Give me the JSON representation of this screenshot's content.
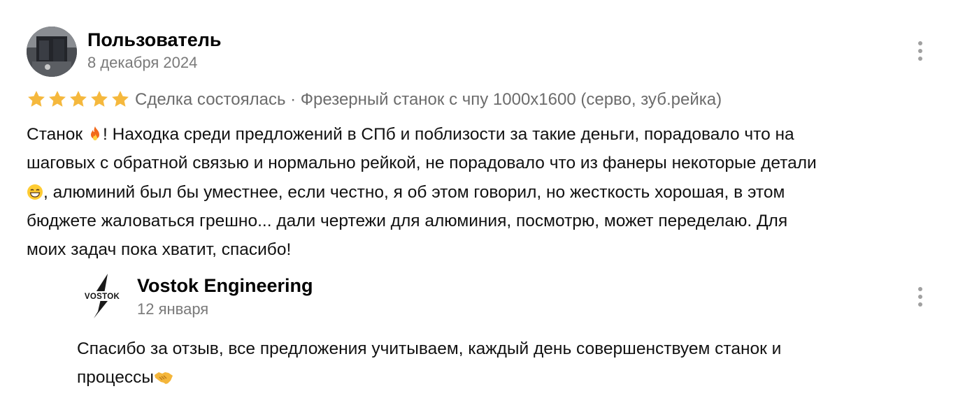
{
  "review": {
    "author": "Пользователь",
    "date": "8 декабря 2024",
    "rating": 5,
    "rating_max": 5,
    "deal_status": "Сделка состоялась · Фрезерный станок с чпу 1000x1600 (серво, зуб.рейка)",
    "text_lines": [
      "Станок ",
      "! Находка среди предложений в СПб и поблизости за такие деньги, порадовало что на",
      "шаговых с обратной связью и нормально рейкой, не порадовало что из фанеры некоторые детали",
      ", алюминий был бы уместнее, если честно, я об этом говорил, но жесткость хорошая, в этом",
      "бюджете жаловаться грешно... дали чертежи для алюминия, посмотрю, может переделаю. Для",
      "моих задач пока хватит, спасибо!"
    ],
    "emoji": [
      "fire-emoji",
      "grin-emoji"
    ],
    "star_color": "#f5b83d"
  },
  "reply": {
    "author": "Vostok Engineering",
    "date": "12 января",
    "logo_text": "VOSTOK",
    "text_lines": [
      "Спасибо за отзыв, все предложения учитываем, каждый день совершенствуем станок и",
      "процессы"
    ],
    "emoji": [
      "handshake-emoji"
    ]
  },
  "icons": {
    "menu": "more-vertical-icon"
  }
}
